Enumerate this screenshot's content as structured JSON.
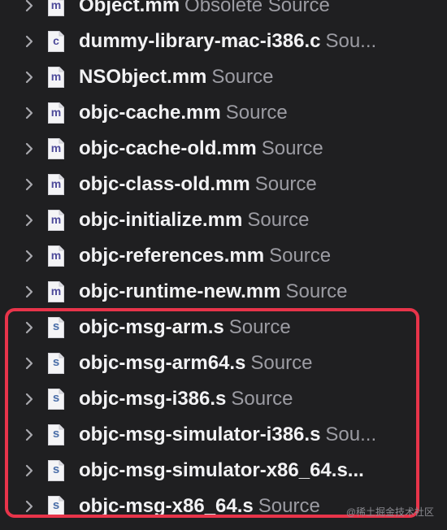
{
  "file_list": {
    "rows": [
      {
        "name": "Object.mm",
        "kind": "Obsolete Source",
        "icon": "mm-file-icon",
        "letter": "m"
      },
      {
        "name": "dummy-library-mac-i386.c",
        "kind": "Sou...",
        "icon": "c-file-icon",
        "letter": "c"
      },
      {
        "name": "NSObject.mm",
        "kind": "Source",
        "icon": "mm-file-icon",
        "letter": "m"
      },
      {
        "name": "objc-cache.mm",
        "kind": "Source",
        "icon": "mm-file-icon",
        "letter": "m"
      },
      {
        "name": "objc-cache-old.mm",
        "kind": "Source",
        "icon": "mm-file-icon",
        "letter": "m"
      },
      {
        "name": "objc-class-old.mm",
        "kind": "Source",
        "icon": "mm-file-icon",
        "letter": "m"
      },
      {
        "name": "objc-initialize.mm",
        "kind": "Source",
        "icon": "mm-file-icon",
        "letter": "m"
      },
      {
        "name": "objc-references.mm",
        "kind": "Source",
        "icon": "mm-file-icon",
        "letter": "m"
      },
      {
        "name": "objc-runtime-new.mm",
        "kind": "Source",
        "icon": "mm-file-icon",
        "letter": "m"
      },
      {
        "name": "objc-msg-arm.s",
        "kind": "Source",
        "icon": "asm-file-icon",
        "letter": "s"
      },
      {
        "name": "objc-msg-arm64.s",
        "kind": "Source",
        "icon": "asm-file-icon",
        "letter": "s"
      },
      {
        "name": "objc-msg-i386.s",
        "kind": "Source",
        "icon": "asm-file-icon",
        "letter": "s"
      },
      {
        "name": "objc-msg-simulator-i386.s",
        "kind": "Sou...",
        "icon": "asm-file-icon",
        "letter": "s"
      },
      {
        "name": "objc-msg-simulator-x86_64.s...",
        "kind": "",
        "icon": "asm-file-icon",
        "letter": "s"
      },
      {
        "name": "objc-msg-x86_64.s",
        "kind": "Source",
        "icon": "asm-file-icon",
        "letter": "s"
      }
    ]
  },
  "highlight": {
    "color": "#e8344a"
  },
  "watermark": {
    "text": "@稀土掘金技术社区"
  },
  "colors": {
    "background": "#1f1f21",
    "name": "#f2f2f4",
    "kind": "#9c9ca3"
  }
}
